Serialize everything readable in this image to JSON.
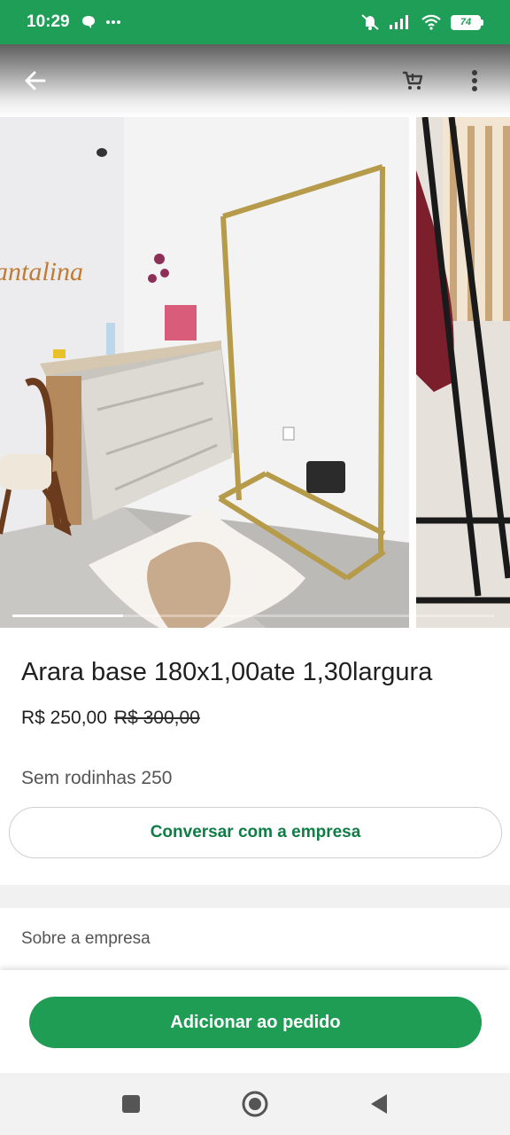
{
  "status_bar": {
    "time": "10:29",
    "battery": "74",
    "icons": [
      "chat-bubble-icon",
      "more-dots-icon",
      "mute-icon",
      "signal-icon",
      "wifi-icon",
      "battery-icon"
    ]
  },
  "app_bar": {
    "icons": [
      "back-arrow-icon",
      "cart-icon",
      "more-vert-icon"
    ]
  },
  "gallery": {
    "logo_text": "antalina",
    "image_count_visible": 2,
    "progress": 0.23
  },
  "product": {
    "title": "Arara base 180x1,00ate 1,30largura",
    "price": "R$ 250,00",
    "old_price": "R$ 300,00",
    "description": "Sem rodinhas 250"
  },
  "chat_button": {
    "label": "Conversar com a empresa"
  },
  "about": {
    "label": "Sobre a empresa"
  },
  "add_button": {
    "label": "Adicionar ao pedido"
  },
  "nav_bar": {
    "icons": [
      "recents-square-icon",
      "home-circle-icon",
      "back-triangle-icon"
    ]
  },
  "colors": {
    "brand_green": "#1e9e57",
    "link_green": "#0f7d45"
  }
}
